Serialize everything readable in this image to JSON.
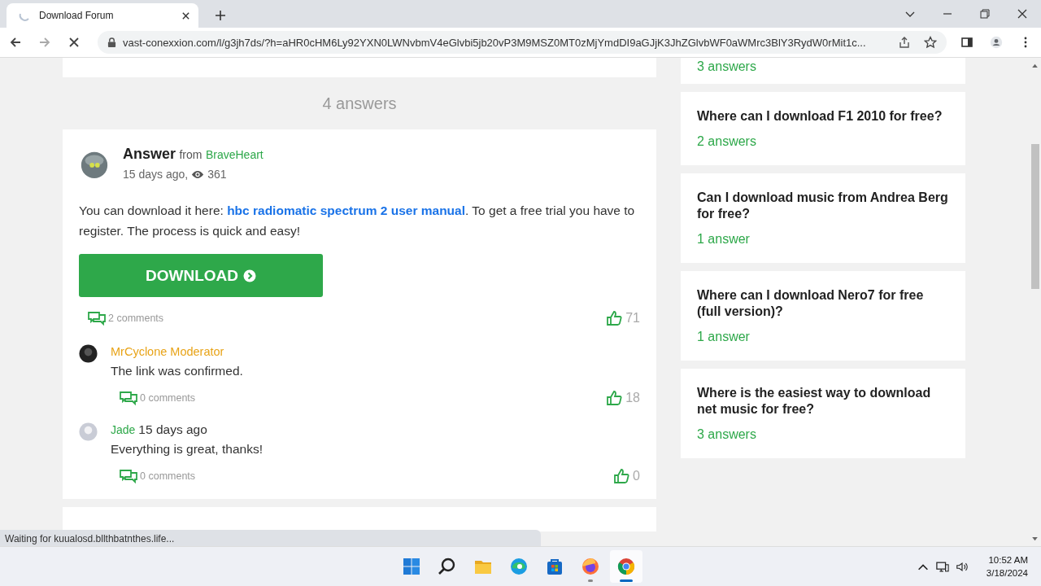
{
  "browser": {
    "tab_title": "Download Forum",
    "url": "vast-conexxion.com/l/g3jh7ds/?h=aHR0cHM6Ly92YXN0LWNvbmV4eGlvbi5jb20vP3M9MSZ0MT0zMjYmdDI9aGJjK3JhZGlvbWF0aWMrc3BlY3RydW0rMit1c...",
    "status": "Waiting for kuualosd.bllthbatnthes.life..."
  },
  "answers_heading": "4 answers",
  "answer": {
    "label": "Answer",
    "from": "from",
    "author": "BraveHeart",
    "time": "15 days ago,",
    "views": "361",
    "body_before": "You can download it here:",
    "link": "hbc radiomatic spectrum 2 user manual",
    "body_after": ". To get a free trial you have to register. The process is quick and easy!",
    "button": "DOWNLOAD",
    "comments": "2 comments",
    "likes": "71"
  },
  "comments": [
    {
      "author": "MrCyclone Moderator",
      "kind": "moderator",
      "text": "The link was confirmed.",
      "comments": "0 comments",
      "likes": "18"
    },
    {
      "author": "Jade",
      "kind": "user",
      "time": "15 days ago",
      "text": "Everything is great, thanks!",
      "comments": "0 comments",
      "likes": "0"
    }
  ],
  "sidebar": {
    "questions": [
      {
        "answers": "3 answers"
      },
      {
        "title": "Where can I download F1 2010 for free?",
        "answers": "2 answers"
      },
      {
        "title": "Can I download music from Andrea Berg for free?",
        "answers": "1 answer"
      },
      {
        "title": "Where can I download Nero7 for free (full version)?",
        "answers": "1 answer"
      },
      {
        "title": "Where is the easiest way to download net music for free?",
        "answers": "3 answers"
      }
    ]
  },
  "taskbar": {
    "apps": [
      {
        "kind": "start",
        "selected": false,
        "running": false
      },
      {
        "kind": "search",
        "selected": false,
        "running": false
      },
      {
        "kind": "files",
        "selected": false,
        "running": false
      },
      {
        "kind": "edge",
        "selected": false,
        "running": false
      },
      {
        "kind": "store",
        "selected": false,
        "running": false
      },
      {
        "kind": "firefox",
        "selected": false,
        "running": true
      },
      {
        "kind": "chrome",
        "selected": true,
        "running": true
      }
    ],
    "time": "10:52 AM",
    "date": "3/18/2024"
  }
}
